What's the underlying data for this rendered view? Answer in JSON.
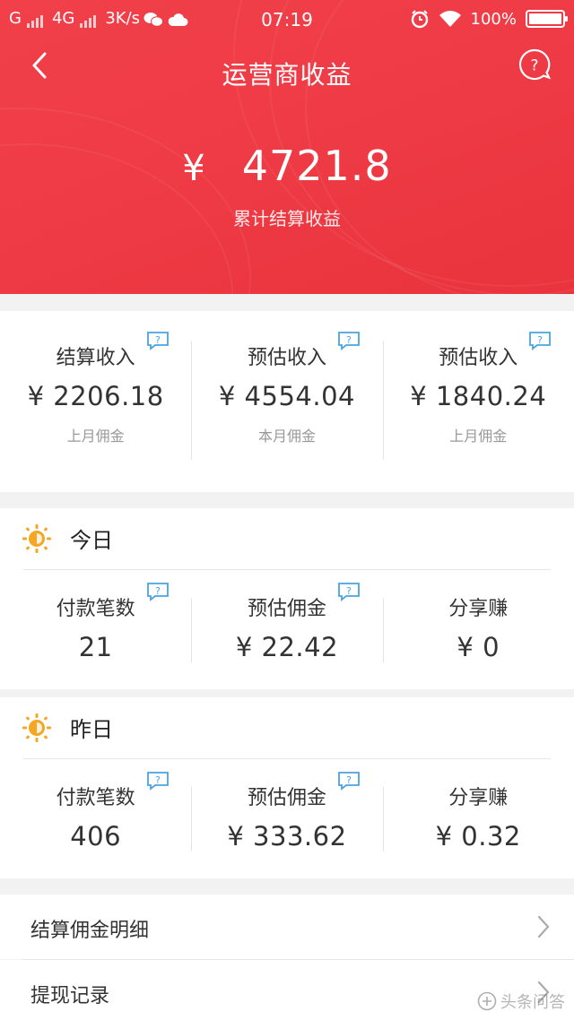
{
  "status_bar": {
    "signal1": "G",
    "signal2": "4G",
    "speed": "3K/s",
    "time": "07:19",
    "battery": "100%",
    "icons": [
      "wechat-icon",
      "cloud-icon",
      "alarm-icon",
      "wifi-icon",
      "battery-icon"
    ]
  },
  "nav": {
    "title": "运营商收益",
    "back_icon": "chevron-left-icon",
    "help_icon": "question-bubble-icon"
  },
  "hero": {
    "currency": "¥",
    "amount": "4721.8",
    "label": "累计结算收益",
    "color": "#ee3b45"
  },
  "summary": [
    {
      "title": "结算收入",
      "value": "¥  2206.18",
      "sub": "上月佣金"
    },
    {
      "title": "预估收入",
      "value": "¥ 4554.04",
      "sub": "本月佣金"
    },
    {
      "title": "预估收入",
      "value": "¥  1840.24",
      "sub": "上月佣金"
    }
  ],
  "today": {
    "heading": "今日",
    "stats": [
      {
        "title": "付款笔数",
        "value": "21",
        "has_help": true
      },
      {
        "title": "预估佣金",
        "value": "¥ 22.42",
        "has_help": true
      },
      {
        "title": "分享赚",
        "value": "¥ 0",
        "has_help": false
      }
    ]
  },
  "yesterday": {
    "heading": "昨日",
    "stats": [
      {
        "title": "付款笔数",
        "value": "406",
        "has_help": true
      },
      {
        "title": "预估佣金",
        "value": "¥ 333.62",
        "has_help": true
      },
      {
        "title": "分享赚",
        "value": "¥ 0.32",
        "has_help": false
      }
    ]
  },
  "menu": [
    {
      "label": "结算佣金明细"
    },
    {
      "label": "提现记录"
    }
  ],
  "watermark": "头条问答",
  "colors": {
    "accent_red": "#ee3b45",
    "help_blue": "#4aa3df",
    "sun_orange": "#f5a623"
  }
}
